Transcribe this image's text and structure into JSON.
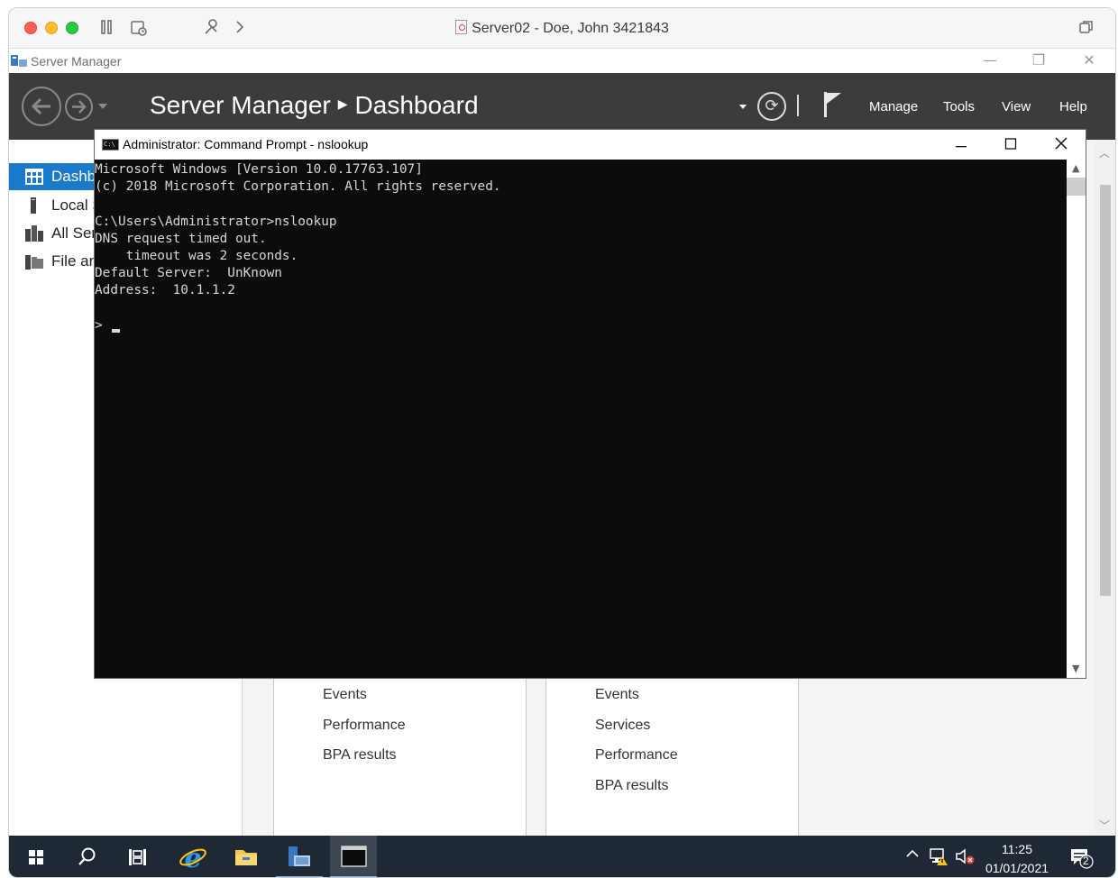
{
  "mac": {
    "title": "Server02 - Doe, John 3421843"
  },
  "server_manager": {
    "window_title": "Server Manager",
    "breadcrumb_root": "Server Manager",
    "breadcrumb_page": "Dashboard",
    "menu": {
      "manage": "Manage",
      "tools": "Tools",
      "view": "View",
      "help": "Help"
    },
    "sidebar": [
      {
        "label": "Dashb",
        "icon": "dashboard-icon",
        "active": true
      },
      {
        "label": "Local S",
        "icon": "local-server-icon",
        "active": false
      },
      {
        "label": "All Ser",
        "icon": "all-servers-icon",
        "active": false
      },
      {
        "label": "File an",
        "icon": "file-services-icon",
        "active": false
      }
    ],
    "tile_left_links": [
      "Events",
      "Performance",
      "BPA results"
    ],
    "tile_right_links": [
      "Events",
      "Services",
      "Performance",
      "BPA results"
    ]
  },
  "cmd": {
    "title": "Administrator: Command Prompt - nslookup",
    "lines": [
      "Microsoft Windows [Version 10.0.17763.107]",
      "(c) 2018 Microsoft Corporation. All rights reserved.",
      "",
      "C:\\Users\\Administrator>nslookup",
      "DNS request timed out.",
      "    timeout was 2 seconds.",
      "Default Server:  UnKnown",
      "Address:  10.1.1.2",
      ""
    ],
    "prompt": ">"
  },
  "taskbar": {
    "time": "11:25",
    "date": "01/01/2021",
    "notification_count": "2"
  }
}
